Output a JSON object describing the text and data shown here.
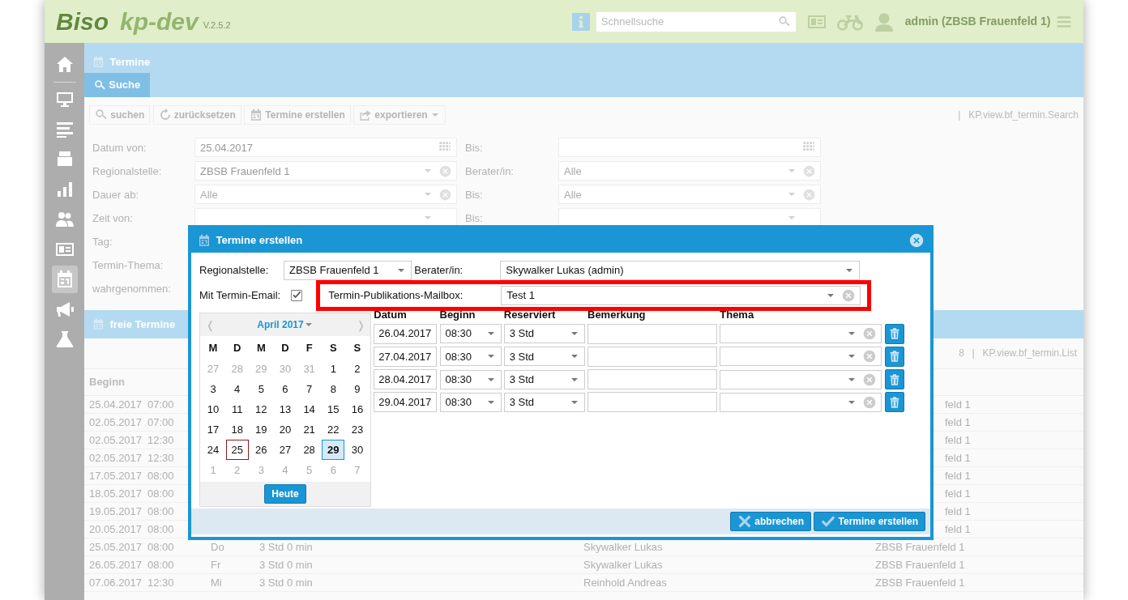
{
  "header": {
    "logo": "Biso",
    "app": "kp-dev",
    "version": "V.2.5.2",
    "search": {
      "placeholder": "Schnellsuche"
    },
    "user": "admin (ZBSB Frauenfeld 1)"
  },
  "sidebar": {
    "items": [
      {
        "kind": "home",
        "selected": false
      },
      {
        "kind": "monitor",
        "selected": false
      },
      {
        "kind": "lines",
        "selected": false
      },
      {
        "kind": "tray",
        "selected": false
      },
      {
        "kind": "chart",
        "selected": false
      },
      {
        "kind": "people",
        "selected": false
      },
      {
        "kind": "card",
        "selected": false
      },
      {
        "kind": "calendar",
        "selected": true
      },
      {
        "kind": "megaphone",
        "selected": false
      },
      {
        "kind": "flask",
        "selected": false
      }
    ]
  },
  "page": {
    "title": "Termine",
    "tabs": [
      {
        "label": "Suche",
        "selected": true
      }
    ]
  },
  "toolbar": {
    "buttons": [
      {
        "kind": "search",
        "label": "suchen"
      },
      {
        "kind": "refresh",
        "label": "zurücksetzen"
      },
      {
        "kind": "calendar",
        "label": "Termine erstellen"
      },
      {
        "kind": "share",
        "label": "exportieren",
        "dropdown": true
      }
    ],
    "separator": "|",
    "view": "KP.view.bf_termin.Search"
  },
  "filters": [
    {
      "label": "Datum von:",
      "field": {
        "kind": "date",
        "value": "25.04.2017"
      },
      "right_label": "Bis:",
      "right_field": {
        "kind": "date"
      }
    },
    {
      "label": "Regionalstelle:",
      "field": {
        "kind": "select",
        "value": "ZBSB Frauenfeld 1",
        "clearable": true
      },
      "right_label": "Berater/in:",
      "right_field": {
        "kind": "select",
        "placeholder": "Alle",
        "clearable": true
      }
    },
    {
      "label": "Dauer ab:",
      "field": {
        "kind": "select",
        "placeholder": "Alle",
        "clearable": true
      },
      "right_label": "Bis:",
      "right_field": {
        "kind": "select",
        "placeholder": "Alle",
        "clearable": true
      }
    },
    {
      "label": "Zeit von:",
      "field": {
        "kind": "select"
      },
      "right_label": "Bis:",
      "right_field": {
        "kind": "select"
      }
    },
    {
      "label": "Tag:"
    },
    {
      "label": "Termin-Thema:"
    },
    {
      "label": "wahrgenommen:"
    }
  ],
  "list": {
    "title": "freie Termine",
    "count": "8",
    "separator": "|",
    "view": "KP.view.bf_termin.List",
    "columns": [
      "Beginn"
    ],
    "rows": [
      {
        "date": "25.04.2017",
        "time": "07:00",
        "region": "feld 1"
      },
      {
        "date": "02.05.2017",
        "time": "07:00",
        "region": "feld 1"
      },
      {
        "date": "02.05.2017",
        "time": "12:30",
        "region": "feld 1"
      },
      {
        "date": "02.05.2017",
        "time": "12:30",
        "region": "feld 1"
      },
      {
        "date": "17.05.2017",
        "time": "08:00",
        "region": "feld 1"
      },
      {
        "date": "18.05.2017",
        "time": "08:00",
        "region": "feld 1"
      },
      {
        "date": "19.05.2017",
        "time": "08:00",
        "region": "feld 1"
      },
      {
        "date": "20.05.2017",
        "time": "08:00",
        "region": "feld 1"
      },
      {
        "date": "25.05.2017",
        "time": "08:00",
        "day": "Do",
        "duration": "3 Std 0 min",
        "advisor": "Skywalker Lukas",
        "region": "ZBSB Frauenfeld 1"
      },
      {
        "date": "26.05.2017",
        "time": "08:00",
        "day": "Fr",
        "duration": "3 Std 0 min",
        "advisor": "Skywalker Lukas",
        "region": "ZBSB Frauenfeld 1"
      },
      {
        "date": "07.06.2017",
        "time": "12:30",
        "day": "Mi",
        "duration": "3 Std 0 min",
        "advisor": "Reinhold Andreas",
        "region": "ZBSB Frauenfeld 1"
      }
    ]
  },
  "dialog": {
    "title": "Termine erstellen",
    "region": {
      "label": "Regionalstelle:",
      "value": "ZBSB Frauenfeld 1"
    },
    "advisor": {
      "label": "Berater/in:",
      "value": "Skywalker Lukas (admin)"
    },
    "email": {
      "label": "Mit Termin-Email:",
      "checked": true
    },
    "mailbox": {
      "label": "Termin-Publikations-Mailbox:",
      "value": "Test 1",
      "highlighted": true
    },
    "calendar": {
      "prev": "❬",
      "next": "❭",
      "month": "April 2017",
      "weekdays": [
        "M",
        "D",
        "M",
        "D",
        "F",
        "S",
        "S"
      ],
      "weeks": [
        [
          {
            "day": "27",
            "outside": true,
            "today": false,
            "selected": false
          },
          {
            "day": "28",
            "outside": true,
            "today": false,
            "selected": false
          },
          {
            "day": "29",
            "outside": true,
            "today": false,
            "selected": false
          },
          {
            "day": "30",
            "outside": true,
            "today": false,
            "selected": false
          },
          {
            "day": "31",
            "outside": true,
            "today": false,
            "selected": false
          },
          {
            "day": "1",
            "outside": false,
            "today": false,
            "selected": false
          },
          {
            "day": "2",
            "outside": false,
            "today": false,
            "selected": false
          }
        ],
        [
          {
            "day": "3",
            "outside": false,
            "today": false,
            "selected": false
          },
          {
            "day": "4",
            "outside": false,
            "today": false,
            "selected": false
          },
          {
            "day": "5",
            "outside": false,
            "today": false,
            "selected": false
          },
          {
            "day": "6",
            "outside": false,
            "today": false,
            "selected": false
          },
          {
            "day": "7",
            "outside": false,
            "today": false,
            "selected": false
          },
          {
            "day": "8",
            "outside": false,
            "today": false,
            "selected": false
          },
          {
            "day": "9",
            "outside": false,
            "today": false,
            "selected": false
          }
        ],
        [
          {
            "day": "10",
            "outside": false,
            "today": false,
            "selected": false
          },
          {
            "day": "11",
            "outside": false,
            "today": false,
            "selected": false
          },
          {
            "day": "12",
            "outside": false,
            "today": false,
            "selected": false
          },
          {
            "day": "13",
            "outside": false,
            "today": false,
            "selected": false
          },
          {
            "day": "14",
            "outside": false,
            "today": false,
            "selected": false
          },
          {
            "day": "15",
            "outside": false,
            "today": false,
            "selected": false
          },
          {
            "day": "16",
            "outside": false,
            "today": false,
            "selected": false
          }
        ],
        [
          {
            "day": "17",
            "outside": false,
            "today": false,
            "selected": false
          },
          {
            "day": "18",
            "outside": false,
            "today": false,
            "selected": false
          },
          {
            "day": "19",
            "outside": false,
            "today": false,
            "selected": false
          },
          {
            "day": "20",
            "outside": false,
            "today": false,
            "selected": false
          },
          {
            "day": "21",
            "outside": false,
            "today": false,
            "selected": false
          },
          {
            "day": "22",
            "outside": false,
            "today": false,
            "selected": false
          },
          {
            "day": "23",
            "outside": false,
            "today": false,
            "selected": false
          }
        ],
        [
          {
            "day": "24",
            "outside": false,
            "today": false,
            "selected": false
          },
          {
            "day": "25",
            "outside": false,
            "today": true,
            "selected": false
          },
          {
            "day": "26",
            "outside": false,
            "today": false,
            "selected": false
          },
          {
            "day": "27",
            "outside": false,
            "today": false,
            "selected": false
          },
          {
            "day": "28",
            "outside": false,
            "today": false,
            "selected": false
          },
          {
            "day": "29",
            "outside": false,
            "today": false,
            "selected": true
          },
          {
            "day": "30",
            "outside": false,
            "today": false,
            "selected": false
          }
        ],
        [
          {
            "day": "1",
            "outside": true,
            "today": false,
            "selected": false
          },
          {
            "day": "2",
            "outside": true,
            "today": false,
            "selected": false
          },
          {
            "day": "3",
            "outside": true,
            "today": false,
            "selected": false
          },
          {
            "day": "4",
            "outside": true,
            "today": false,
            "selected": false
          },
          {
            "day": "5",
            "outside": true,
            "today": false,
            "selected": false
          },
          {
            "day": "6",
            "outside": true,
            "today": false,
            "selected": false
          },
          {
            "day": "7",
            "outside": true,
            "today": false,
            "selected": false
          }
        ]
      ],
      "today_button": "Heute"
    },
    "columns": [
      "Datum",
      "Beginn",
      "Reserviert",
      "Bemerkung",
      "Thema"
    ],
    "rows": [
      {
        "date": "26.04.2017",
        "time": "08:30",
        "duration": "3 Std"
      },
      {
        "date": "27.04.2017",
        "time": "08:30",
        "duration": "3 Std"
      },
      {
        "date": "28.04.2017",
        "time": "08:30",
        "duration": "3 Std"
      },
      {
        "date": "29.04.2017",
        "time": "08:30",
        "duration": "3 Std"
      }
    ],
    "buttons": [
      {
        "kind": "cancel",
        "label": "abbrechen"
      },
      {
        "kind": "confirm",
        "label": "Termine erstellen"
      }
    ]
  }
}
